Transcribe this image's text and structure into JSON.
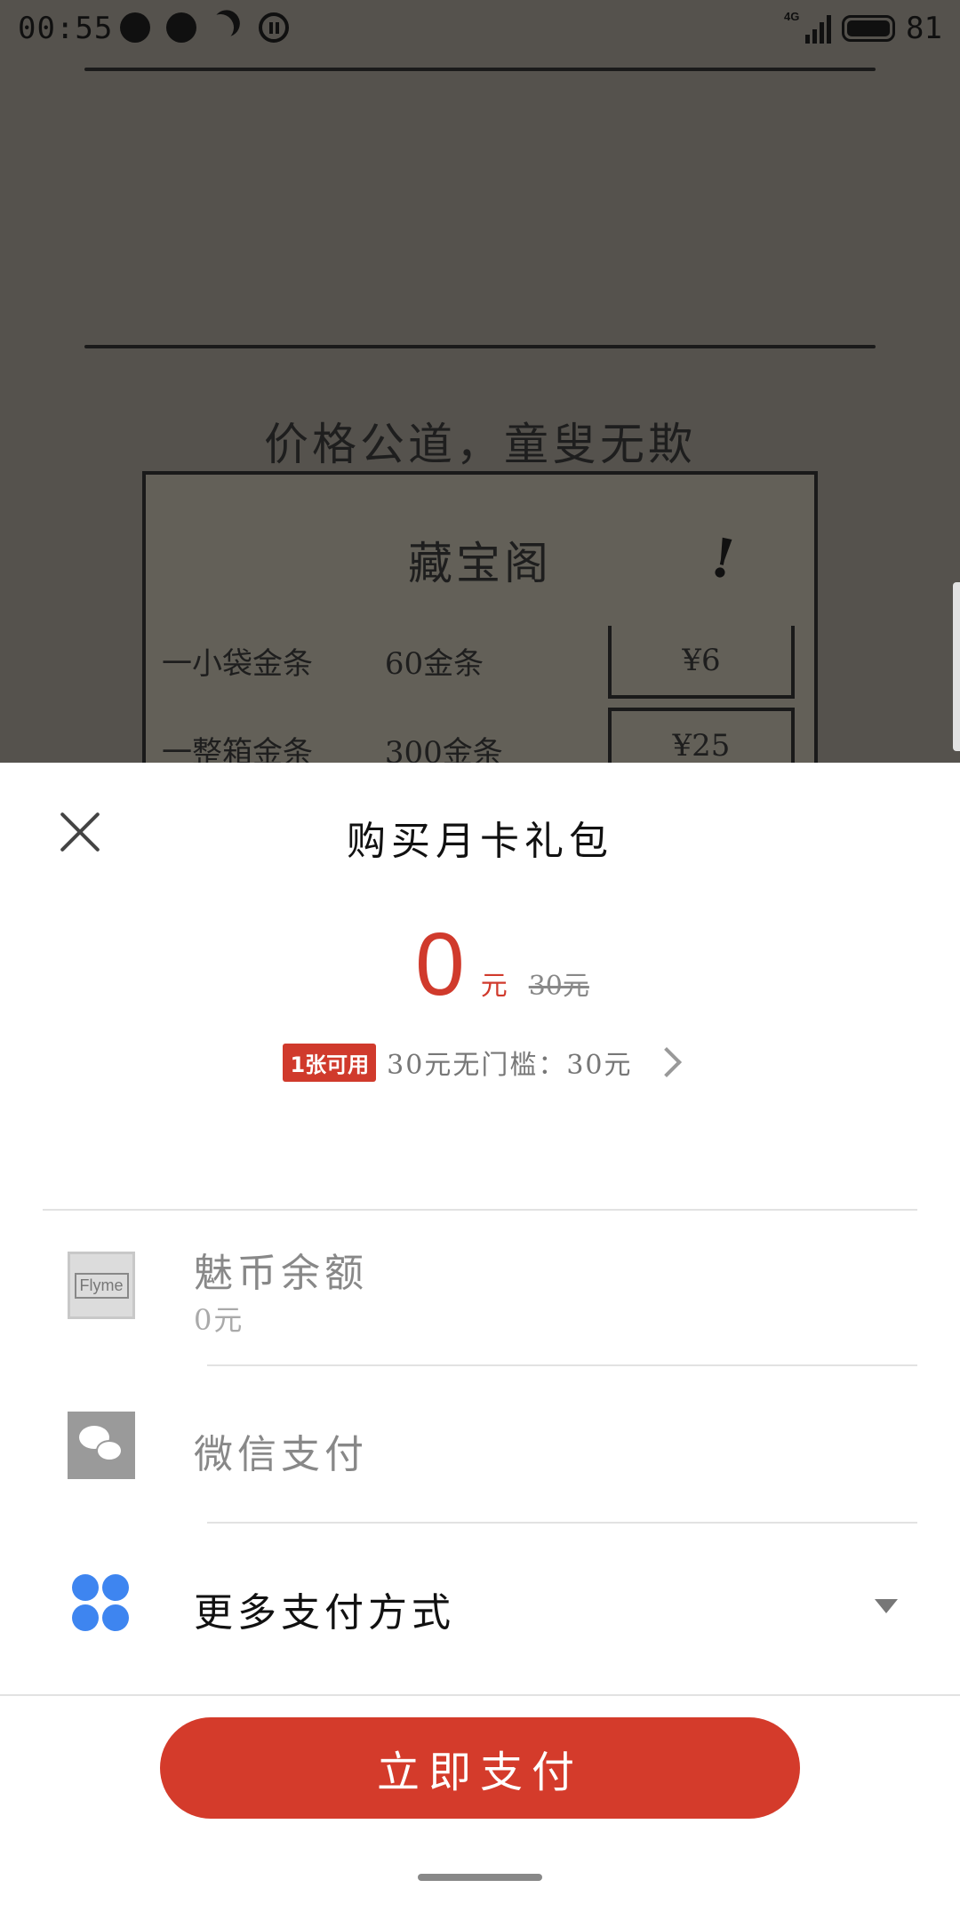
{
  "status_bar": {
    "time": "00:55",
    "network": "4G",
    "battery": "81"
  },
  "background": {
    "heading": "价格公道，童叟无欺",
    "shop_title": "藏宝阁",
    "items": [
      {
        "name": "一小袋金条",
        "amount": "60金条",
        "price": "¥6"
      },
      {
        "name": "一整箱金条",
        "amount": "300金条",
        "price": "¥25"
      }
    ]
  },
  "sheet": {
    "title": "购买月卡礼包",
    "price": "0",
    "price_unit": "元",
    "original_price": "30元",
    "coupon": {
      "badge": "1张可用",
      "text": "30元无门槛：30元"
    },
    "payment_methods": [
      {
        "label": "魅币余额",
        "sub": "0元",
        "icon": "flyme-icon",
        "icon_text": "Flyme"
      },
      {
        "label": "微信支付",
        "icon": "wechat-icon"
      },
      {
        "label": "更多支付方式",
        "icon": "more-apps-icon"
      }
    ],
    "pay_button": "立即支付"
  },
  "colors": {
    "accent": "#d43b2b",
    "more_icon": "#3e85f0",
    "overlay": "#55524d"
  }
}
